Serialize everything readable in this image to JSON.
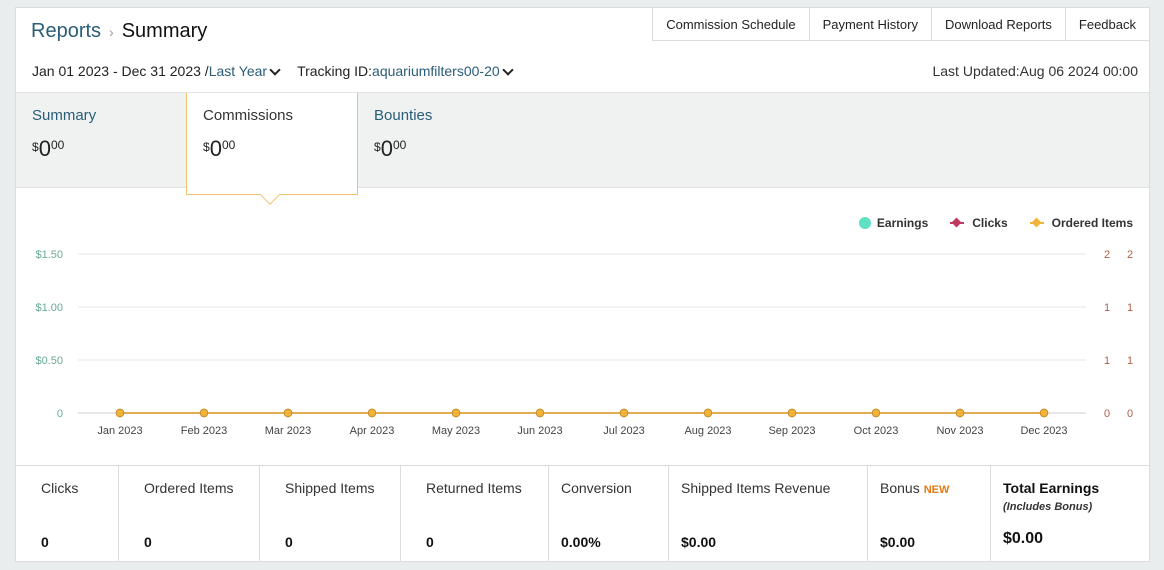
{
  "breadcrumb": {
    "reports": "Reports",
    "separator": "›",
    "current": "Summary"
  },
  "top_links": [
    "Commission Schedule",
    "Payment History",
    "Download Reports",
    "Feedback"
  ],
  "filters": {
    "date_range": "Jan 01 2023 - Dec 31 2023 /",
    "period": "Last Year",
    "tracking_label": "Tracking ID:",
    "tracking_id": "aquariumfilters00-20"
  },
  "last_updated": "Last Updated:Aug 06 2024 00:00",
  "tabs": [
    {
      "label": "Summary",
      "symbol": "$",
      "value": "0",
      "cents": "00",
      "active": false
    },
    {
      "label": "Commissions",
      "symbol": "$",
      "value": "0",
      "cents": "00",
      "active": true
    },
    {
      "label": "Bounties",
      "symbol": "$",
      "value": "0",
      "cents": "00",
      "active": false
    }
  ],
  "legend": [
    {
      "label": "Earnings",
      "color": "#5ee0c3",
      "shape": "circle"
    },
    {
      "label": "Clicks",
      "color": "#c0395f",
      "shape": "diamond"
    },
    {
      "label": "Ordered Items",
      "color": "#f0b43c",
      "shape": "diamond"
    }
  ],
  "chart_data": {
    "type": "line",
    "categories": [
      "Jan 2023",
      "Feb 2023",
      "Mar 2023",
      "Apr 2023",
      "May 2023",
      "Jun 2023",
      "Jul 2023",
      "Aug 2023",
      "Sep 2023",
      "Oct 2023",
      "Nov 2023",
      "Dec 2023"
    ],
    "series": [
      {
        "name": "Earnings",
        "axis": "left",
        "color": "#5ee0c3",
        "values": [
          0,
          0,
          0,
          0,
          0,
          0,
          0,
          0,
          0,
          0,
          0,
          0
        ]
      },
      {
        "name": "Clicks",
        "axis": "right1",
        "color": "#c0395f",
        "values": [
          0,
          0,
          0,
          0,
          0,
          0,
          0,
          0,
          0,
          0,
          0,
          0
        ]
      },
      {
        "name": "Ordered Items",
        "axis": "right2",
        "color": "#f0b43c",
        "values": [
          0,
          0,
          0,
          0,
          0,
          0,
          0,
          0,
          0,
          0,
          0,
          0
        ]
      }
    ],
    "y_left": {
      "ticks": [
        "0",
        "$0.50",
        "$1.00",
        "$1.50"
      ],
      "ylim": [
        0,
        1.5
      ]
    },
    "y_right1": {
      "ticks": [
        "0",
        "1",
        "1",
        "2"
      ]
    },
    "y_right2": {
      "ticks": [
        "0",
        "1",
        "1",
        "2"
      ]
    },
    "grid": true,
    "legend_position": "top-right"
  },
  "stats": [
    {
      "label": "Clicks",
      "value": "0"
    },
    {
      "label": "Ordered Items",
      "value": "0"
    },
    {
      "label": "Shipped Items",
      "value": "0"
    },
    {
      "label": "Returned Items",
      "value": "0"
    },
    {
      "label": "Conversion",
      "value": "0.00%"
    },
    {
      "label": "Shipped Items Revenue",
      "value": "$0.00"
    },
    {
      "label": "Bonus",
      "badge": "NEW",
      "value": "$0.00"
    },
    {
      "label": "Total Earnings",
      "sub": "(Includes Bonus)",
      "value": "$0.00"
    }
  ]
}
